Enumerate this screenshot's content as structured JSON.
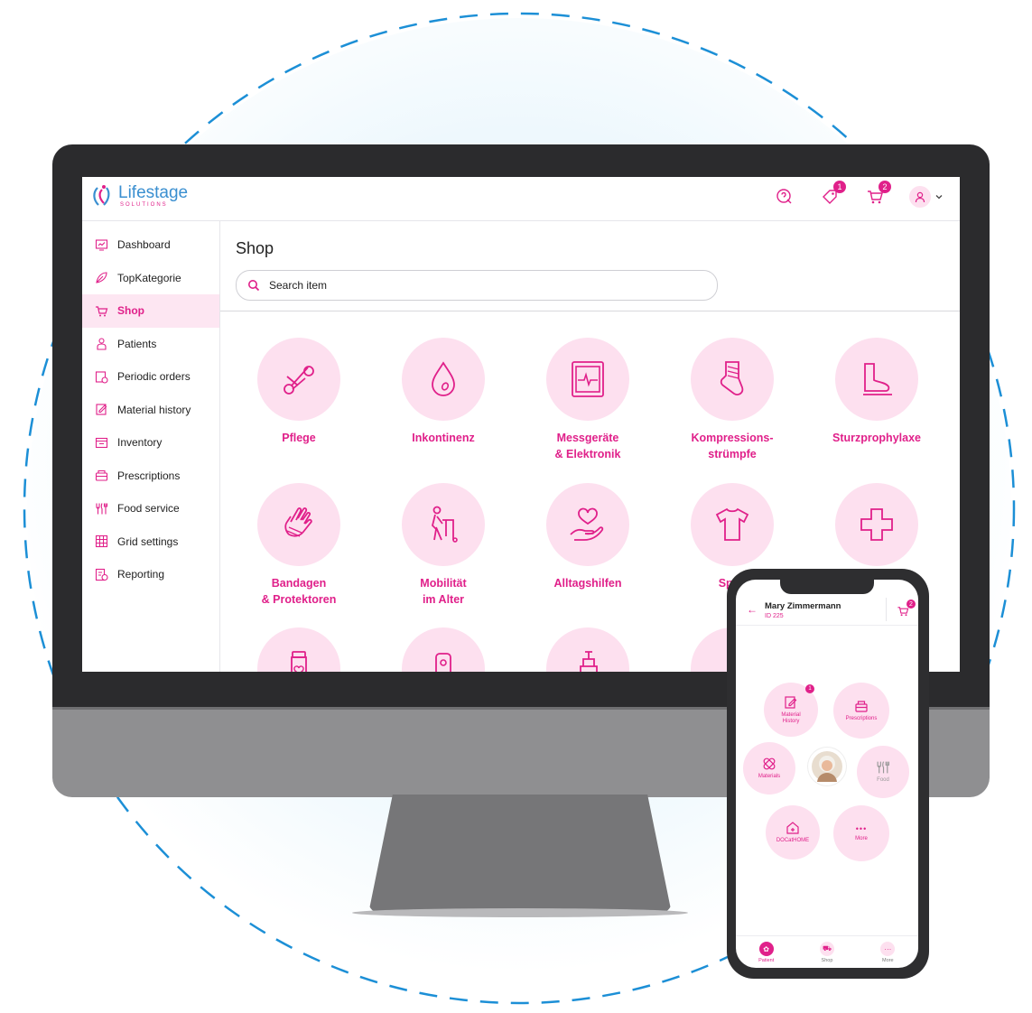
{
  "brand": {
    "name": "Lifestage",
    "sub": "SOLUTIONS"
  },
  "colors": {
    "accent": "#e0208a",
    "accent_light": "#fde0ef",
    "logo_blue": "#3a8fd0"
  },
  "topbar": {
    "notifications_badge": "1",
    "cart_badge": "2"
  },
  "sidebar": {
    "items": [
      {
        "label": "Dashboard",
        "icon": "dashboard-icon"
      },
      {
        "label": "TopKategorie",
        "icon": "leaf-icon"
      },
      {
        "label": "Shop",
        "icon": "cart-icon"
      },
      {
        "label": "Patients",
        "icon": "patient-icon"
      },
      {
        "label": "Periodic orders",
        "icon": "periodic-orders-icon"
      },
      {
        "label": "Material history",
        "icon": "material-history-icon"
      },
      {
        "label": "Inventory",
        "icon": "inventory-icon"
      },
      {
        "label": "Prescriptions",
        "icon": "prescriptions-icon"
      },
      {
        "label": "Food service",
        "icon": "cutlery-icon"
      },
      {
        "label": "Grid settings",
        "icon": "grid-icon"
      },
      {
        "label": "Reporting",
        "icon": "reporting-icon"
      }
    ]
  },
  "main": {
    "title": "Shop",
    "search_placeholder": "Search item",
    "categories": [
      {
        "label": "Pflege",
        "icon": "scissors-icon"
      },
      {
        "label": "Inkontinenz",
        "icon": "drop-icon"
      },
      {
        "label": "Messgeräte\n& Elektronik",
        "icon": "monitor-icon"
      },
      {
        "label": "Kompressions-\nstrümpfe",
        "icon": "stocking-icon"
      },
      {
        "label": "Sturzprophylaxe",
        "icon": "boot-icon"
      },
      {
        "label": "Bandagen\n& Protektoren",
        "icon": "bandaged-hand-icon"
      },
      {
        "label": "Mobilität\nim Alter",
        "icon": "walker-icon"
      },
      {
        "label": "Alltagshilfen",
        "icon": "heart-hand-icon"
      },
      {
        "label": "Spite",
        "icon": "shirt-icon"
      },
      {
        "label": "",
        "icon": "cross-icon"
      }
    ]
  },
  "phone": {
    "patient_name": "Mary Zimmermann",
    "patient_id": "ID 225",
    "cart_badge": "2",
    "bubbles": {
      "material_history": {
        "label": "Material\nHistory",
        "badge": "1"
      },
      "prescriptions": {
        "label": "Prescriptions"
      },
      "materials": {
        "label": "Materials"
      },
      "food": {
        "label": "Food"
      },
      "docathome": {
        "label": "DOCatHOME"
      },
      "more": {
        "label": "More",
        "glyph": "•••"
      }
    },
    "tabs": [
      {
        "label": "Patient"
      },
      {
        "label": "Shop"
      },
      {
        "label": "More"
      }
    ]
  }
}
